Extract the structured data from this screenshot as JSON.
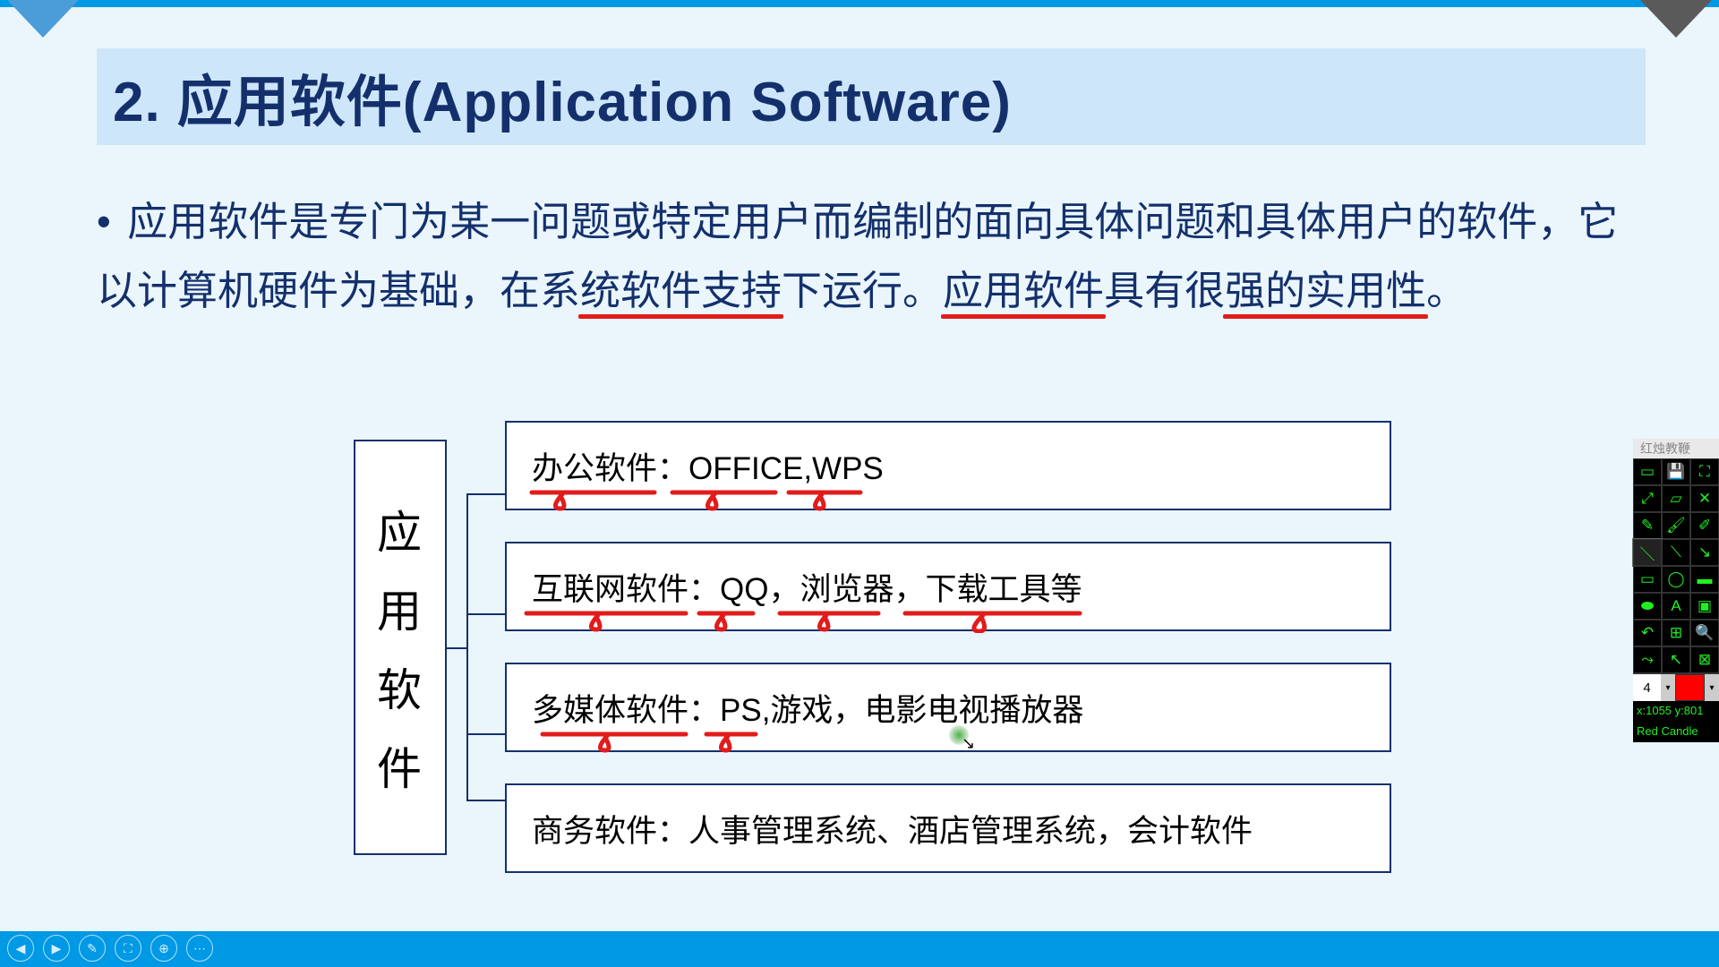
{
  "title": "2. 应用软件(Application Software)",
  "paragraph": {
    "pre1": "应用软件是专门为某一问题或特定用户而编制的面向具体问题和具体用户的软件，它以计算机硬件为基础，在系",
    "u1": "统软件支持",
    "mid1": "下运行。",
    "u2": "应用软件",
    "mid2": "具有很",
    "u3": "强的实用性",
    "post": "。"
  },
  "side_label": [
    "应",
    "用",
    "软",
    "件"
  ],
  "rows": [
    "办公软件：OFFICE,WPS",
    "互联网软件：QQ，浏览器，下载工具等",
    "多媒体软件：PS,游戏，电影电视播放器",
    "商务软件：人事管理系统、酒店管理系统，会计软件"
  ],
  "toolbox": {
    "title": "红烛教鞭",
    "linewidth": "4",
    "coords": "x:1055 y:801",
    "brand": "Red Candle"
  },
  "nav_icons": [
    "◀",
    "▶",
    "✎",
    "⛶",
    "⊕",
    "⋯"
  ]
}
